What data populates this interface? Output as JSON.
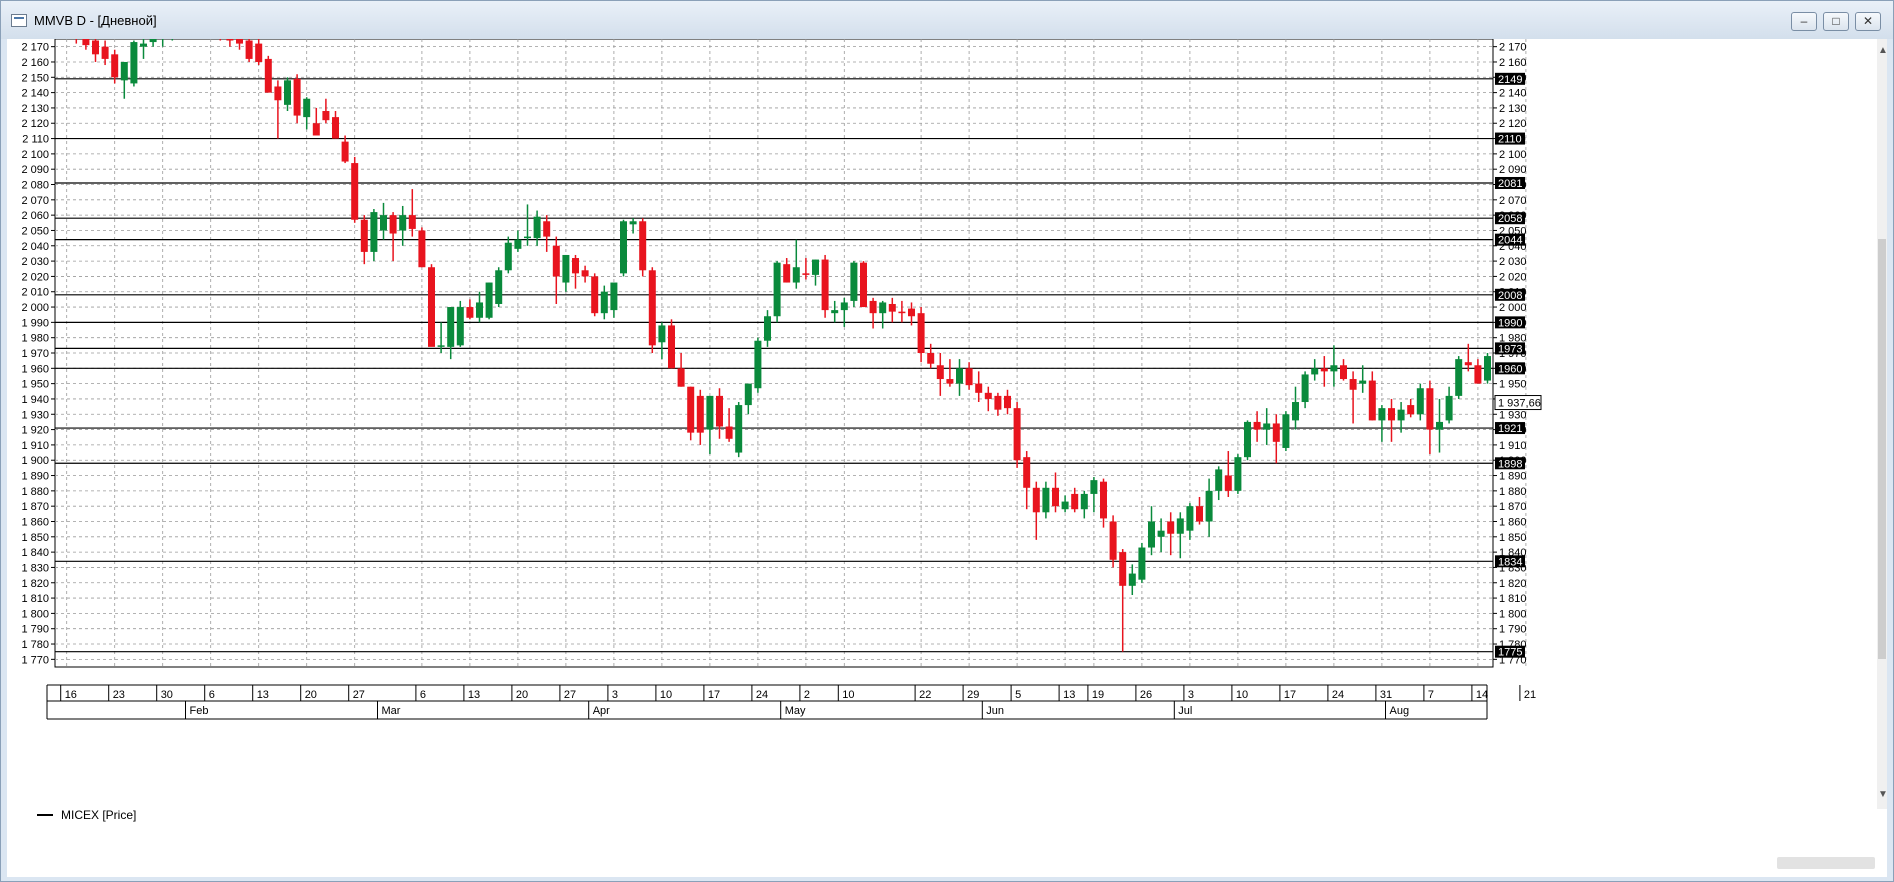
{
  "window": {
    "title": "MMVB D - [Дневной]",
    "buttons": {
      "minimize": "–",
      "maximize": "□",
      "close": "✕"
    }
  },
  "legend": {
    "label": "MICEX [Price]"
  },
  "colors": {
    "up": "#0a8a3c",
    "down": "#e8141e",
    "grid": "#9a9a9a",
    "level": "#000000",
    "badge_bg": "#000000",
    "badge_text": "#ffffff"
  },
  "chart_data": {
    "type": "candlestick",
    "title": "",
    "xlabel": "",
    "ylabel": "",
    "ylim": [
      1765,
      2175
    ],
    "grid": true,
    "yticks": [
      1770,
      1780,
      1790,
      1800,
      1810,
      1820,
      1830,
      1840,
      1850,
      1860,
      1870,
      1880,
      1890,
      1900,
      1910,
      1920,
      1930,
      1940,
      1950,
      1960,
      1970,
      1980,
      1990,
      2000,
      2010,
      2020,
      2030,
      2040,
      2050,
      2060,
      2070,
      2080,
      2090,
      2100,
      2110,
      2120,
      2130,
      2140,
      2150,
      2160,
      2170
    ],
    "ytick_labels": [
      "1 770",
      "1 780",
      "1 790",
      "1 800",
      "1 810",
      "1 820",
      "1 830",
      "1 840",
      "1 850",
      "1 860",
      "1 870",
      "1 880",
      "1 890",
      "1 900",
      "1 910",
      "1 920",
      "1 930",
      "1 940",
      "1 950",
      "1 960",
      "1 970",
      "1 980",
      "1 990",
      "2 000",
      "2 010",
      "2 020",
      "2 030",
      "2 040",
      "2 050",
      "2 060",
      "2 070",
      "2 080",
      "2 090",
      "2 100",
      "2 110",
      "2 120",
      "2 130",
      "2 140",
      "2 150",
      "2 160",
      "2 170"
    ],
    "levels": [
      {
        "value": 2149,
        "label": "2149"
      },
      {
        "value": 2110,
        "label": "2110"
      },
      {
        "value": 2081,
        "label": "2081"
      },
      {
        "value": 2058,
        "label": "2058"
      },
      {
        "value": 2044,
        "label": "2044"
      },
      {
        "value": 2008,
        "label": "2008"
      },
      {
        "value": 1990,
        "label": "1990"
      },
      {
        "value": 1973,
        "label": "1973"
      },
      {
        "value": 1960,
        "label": "1960"
      },
      {
        "value": 1921,
        "label": "1921"
      },
      {
        "value": 1898,
        "label": "1898"
      },
      {
        "value": 1834,
        "label": "1834"
      },
      {
        "value": 1775,
        "label": "1775"
      }
    ],
    "last_price": {
      "value": 1937.66,
      "label": "1 937,66"
    },
    "day_ticks": [
      {
        "label": "16",
        "index": 2
      },
      {
        "label": "23",
        "index": 7
      },
      {
        "label": "30",
        "index": 12
      },
      {
        "label": "6",
        "index": 17
      },
      {
        "label": "13",
        "index": 22
      },
      {
        "label": "20",
        "index": 27
      },
      {
        "label": "27",
        "index": 32
      },
      {
        "label": "6",
        "index": 39
      },
      {
        "label": "13",
        "index": 44
      },
      {
        "label": "20",
        "index": 49
      },
      {
        "label": "27",
        "index": 54
      },
      {
        "label": "3",
        "index": 59
      },
      {
        "label": "10",
        "index": 64
      },
      {
        "label": "17",
        "index": 69
      },
      {
        "label": "24",
        "index": 74
      },
      {
        "label": "2",
        "index": 79
      },
      {
        "label": "10",
        "index": 83
      },
      {
        "label": "22",
        "index": 91
      },
      {
        "label": "29",
        "index": 96
      },
      {
        "label": "5",
        "index": 101
      },
      {
        "label": "13",
        "index": 106
      },
      {
        "label": "19",
        "index": 109
      },
      {
        "label": "26",
        "index": 114
      },
      {
        "label": "3",
        "index": 119
      },
      {
        "label": "10",
        "index": 124
      },
      {
        "label": "17",
        "index": 129
      },
      {
        "label": "24",
        "index": 134
      },
      {
        "label": "31",
        "index": 139
      },
      {
        "label": "7",
        "index": 144
      },
      {
        "label": "14",
        "index": 149
      },
      {
        "label": "21",
        "index": 154
      }
    ],
    "month_ticks": [
      {
        "label": "Feb",
        "index": 15
      },
      {
        "label": "Mar",
        "index": 35
      },
      {
        "label": "Apr",
        "index": 57
      },
      {
        "label": "May",
        "index": 77
      },
      {
        "label": "Jun",
        "index": 98
      },
      {
        "label": "Jul",
        "index": 118
      },
      {
        "label": "Aug",
        "index": 140
      }
    ],
    "candles": [
      [
        2185,
        2190,
        2172,
        2180
      ],
      [
        2190,
        2195,
        2175,
        2178
      ],
      [
        2188,
        2192,
        2178,
        2182
      ],
      [
        2184,
        2188,
        2172,
        2176
      ],
      [
        2178,
        2182,
        2168,
        2171
      ],
      [
        2174,
        2180,
        2160,
        2165
      ],
      [
        2170,
        2174,
        2158,
        2162
      ],
      [
        2165,
        2168,
        2146,
        2150
      ],
      [
        2148,
        2160,
        2136,
        2160
      ],
      [
        2146,
        2174,
        2144,
        2173
      ],
      [
        2170,
        2178,
        2162,
        2172
      ],
      [
        2173,
        2178,
        2170,
        2175
      ],
      [
        2175,
        2182,
        2170,
        2178
      ],
      [
        2180,
        2186,
        2174,
        2182
      ],
      [
        2184,
        2190,
        2178,
        2186
      ],
      [
        2186,
        2192,
        2180,
        2184
      ],
      [
        2184,
        2190,
        2176,
        2180
      ],
      [
        2182,
        2188,
        2176,
        2184
      ],
      [
        2184,
        2188,
        2174,
        2178
      ],
      [
        2178,
        2184,
        2170,
        2174
      ],
      [
        2175,
        2180,
        2168,
        2172
      ],
      [
        2174,
        2177,
        2160,
        2162
      ],
      [
        2172,
        2175,
        2158,
        2160
      ],
      [
        2162,
        2164,
        2140,
        2140
      ],
      [
        2144,
        2148,
        2110,
        2135
      ],
      [
        2132,
        2150,
        2128,
        2148
      ],
      [
        2149,
        2152,
        2120,
        2125
      ],
      [
        2124,
        2137,
        2116,
        2136
      ],
      [
        2120,
        2130,
        2112,
        2112
      ],
      [
        2128,
        2136,
        2120,
        2122
      ],
      [
        2124,
        2128,
        2110,
        2110
      ],
      [
        2108,
        2112,
        2094,
        2095
      ],
      [
        2094,
        2098,
        2055,
        2057
      ],
      [
        2057,
        2060,
        2028,
        2036
      ],
      [
        2036,
        2064,
        2030,
        2062
      ],
      [
        2050,
        2068,
        2044,
        2060
      ],
      [
        2060,
        2062,
        2030,
        2048
      ],
      [
        2050,
        2066,
        2040,
        2060
      ],
      [
        2060,
        2077,
        2046,
        2051
      ],
      [
        2050,
        2052,
        2026,
        2026
      ],
      [
        2026,
        2028,
        1975,
        1974
      ],
      [
        1975,
        1990,
        1970,
        1975
      ],
      [
        1974,
        2000,
        1966,
        2000
      ],
      [
        1975,
        2004,
        1974,
        2000
      ],
      [
        2000,
        2005,
        1992,
        1993
      ],
      [
        1993,
        2010,
        1990,
        2003
      ],
      [
        1993,
        2016,
        1992,
        2016
      ],
      [
        2002,
        2026,
        2000,
        2024
      ],
      [
        2024,
        2046,
        2022,
        2042
      ],
      [
        2038,
        2050,
        2036,
        2044
      ],
      [
        2045,
        2067,
        2040,
        2046
      ],
      [
        2045,
        2063,
        2040,
        2059
      ],
      [
        2056,
        2060,
        2036,
        2046
      ],
      [
        2040,
        2046,
        2002,
        2020
      ],
      [
        2016,
        2034,
        2010,
        2034
      ],
      [
        2032,
        2034,
        2012,
        2022
      ],
      [
        2024,
        2027,
        2016,
        2020
      ],
      [
        2020,
        2022,
        1994,
        1996
      ],
      [
        1996,
        2014,
        1992,
        2010
      ],
      [
        1998,
        2016,
        1993,
        2016
      ],
      [
        2022,
        2057,
        2020,
        2056
      ],
      [
        2054,
        2058,
        2048,
        2056
      ],
      [
        2056,
        2058,
        2020,
        2024
      ],
      [
        2024,
        2026,
        1970,
        1975
      ],
      [
        1977,
        1990,
        1966,
        1988
      ],
      [
        1988,
        1992,
        1960,
        1960
      ],
      [
        1960,
        1970,
        1948,
        1948
      ],
      [
        1948,
        1948,
        1913,
        1918
      ],
      [
        1942,
        1946,
        1910,
        1918
      ],
      [
        1920,
        1942,
        1904,
        1942
      ],
      [
        1942,
        1947,
        1914,
        1922
      ],
      [
        1922,
        1934,
        1912,
        1914
      ],
      [
        1905,
        1938,
        1902,
        1936
      ],
      [
        1936,
        1950,
        1930,
        1950
      ],
      [
        1947,
        1980,
        1944,
        1978
      ],
      [
        1978,
        1998,
        1974,
        1994
      ],
      [
        1994,
        2030,
        1990,
        2029
      ],
      [
        2028,
        2032,
        2016,
        2016
      ],
      [
        2016,
        2044,
        2012,
        2026
      ],
      [
        2022,
        2032,
        2018,
        2021
      ],
      [
        2021,
        2031,
        2014,
        2031
      ],
      [
        2031,
        2034,
        1993,
        1998
      ],
      [
        1996,
        2004,
        1990,
        1998
      ],
      [
        1998,
        2006,
        1987,
        2003
      ],
      [
        2004,
        2030,
        2000,
        2029
      ],
      [
        2029,
        2030,
        2000,
        2000
      ],
      [
        2004,
        2006,
        1986,
        1996
      ],
      [
        1996,
        2004,
        1986,
        2003
      ],
      [
        2002,
        2006,
        1990,
        1997
      ],
      [
        1997,
        2004,
        1990,
        1996
      ],
      [
        1999,
        2003,
        1988,
        1994
      ],
      [
        1996,
        2000,
        1964,
        1970
      ],
      [
        1970,
        1976,
        1960,
        1963
      ],
      [
        1962,
        1970,
        1942,
        1953
      ],
      [
        1953,
        1966,
        1948,
        1950
      ],
      [
        1950,
        1966,
        1942,
        1960
      ],
      [
        1960,
        1964,
        1946,
        1949
      ],
      [
        1950,
        1958,
        1938,
        1944
      ],
      [
        1944,
        1948,
        1932,
        1940
      ],
      [
        1942,
        1944,
        1929,
        1933
      ],
      [
        1942,
        1946,
        1930,
        1934
      ],
      [
        1934,
        1938,
        1895,
        1900
      ],
      [
        1902,
        1906,
        1868,
        1882
      ],
      [
        1882,
        1886,
        1848,
        1866
      ],
      [
        1866,
        1886,
        1862,
        1882
      ],
      [
        1882,
        1892,
        1866,
        1870
      ],
      [
        1868,
        1877,
        1866,
        1873
      ],
      [
        1878,
        1882,
        1866,
        1868
      ],
      [
        1868,
        1880,
        1862,
        1878
      ],
      [
        1878,
        1889,
        1866,
        1887
      ],
      [
        1886,
        1888,
        1856,
        1862
      ],
      [
        1860,
        1864,
        1830,
        1835
      ],
      [
        1840,
        1842,
        1775,
        1818
      ],
      [
        1818,
        1832,
        1812,
        1826
      ],
      [
        1822,
        1846,
        1820,
        1843
      ],
      [
        1843,
        1870,
        1838,
        1860
      ],
      [
        1850,
        1862,
        1840,
        1854
      ],
      [
        1860,
        1866,
        1838,
        1852
      ],
      [
        1852,
        1866,
        1836,
        1862
      ],
      [
        1854,
        1872,
        1848,
        1870
      ],
      [
        1870,
        1876,
        1858,
        1860
      ],
      [
        1860,
        1888,
        1850,
        1880
      ],
      [
        1880,
        1896,
        1874,
        1894
      ],
      [
        1890,
        1906,
        1876,
        1880
      ],
      [
        1880,
        1904,
        1878,
        1902
      ],
      [
        1902,
        1926,
        1900,
        1925
      ],
      [
        1925,
        1932,
        1912,
        1920
      ],
      [
        1920,
        1934,
        1910,
        1924
      ],
      [
        1924,
        1930,
        1898,
        1912
      ],
      [
        1908,
        1932,
        1906,
        1930
      ],
      [
        1926,
        1948,
        1920,
        1938
      ],
      [
        1938,
        1958,
        1934,
        1956
      ],
      [
        1956,
        1966,
        1952,
        1960
      ],
      [
        1960,
        1968,
        1948,
        1958
      ],
      [
        1958,
        1975,
        1948,
        1962
      ],
      [
        1962,
        1966,
        1952,
        1953
      ],
      [
        1953,
        1958,
        1924,
        1946
      ],
      [
        1950,
        1962,
        1944,
        1952
      ],
      [
        1952,
        1958,
        1926,
        1926
      ],
      [
        1926,
        1936,
        1912,
        1934
      ],
      [
        1934,
        1940,
        1912,
        1926
      ],
      [
        1926,
        1938,
        1918,
        1933
      ],
      [
        1936,
        1940,
        1928,
        1930
      ],
      [
        1930,
        1950,
        1926,
        1947
      ],
      [
        1947,
        1952,
        1904,
        1920
      ],
      [
        1920,
        1940,
        1905,
        1925
      ],
      [
        1926,
        1948,
        1924,
        1942
      ],
      [
        1942,
        1968,
        1940,
        1966
      ],
      [
        1964,
        1976,
        1958,
        1962
      ],
      [
        1962,
        1966,
        1952,
        1950
      ],
      [
        1952,
        1970,
        1950,
        1968
      ],
      [
        1972,
        1990,
        1970,
        1990
      ],
      [
        1990,
        1991,
        1966,
        1976
      ],
      [
        1976,
        1986,
        1962,
        1962
      ],
      [
        1962,
        1964,
        1936,
        1946
      ],
      [
        1946,
        1952,
        1936,
        1944
      ],
      [
        1950,
        1954,
        1940,
        1952
      ],
      [
        1954,
        1956,
        1940,
        1945
      ],
      [
        1946,
        1948,
        1936,
        1942
      ],
      [
        1944,
        1948,
        1936,
        1942
      ],
      [
        1944,
        1946,
        1920,
        1932
      ],
      [
        1930,
        1942,
        1926,
        1937.66
      ]
    ]
  }
}
